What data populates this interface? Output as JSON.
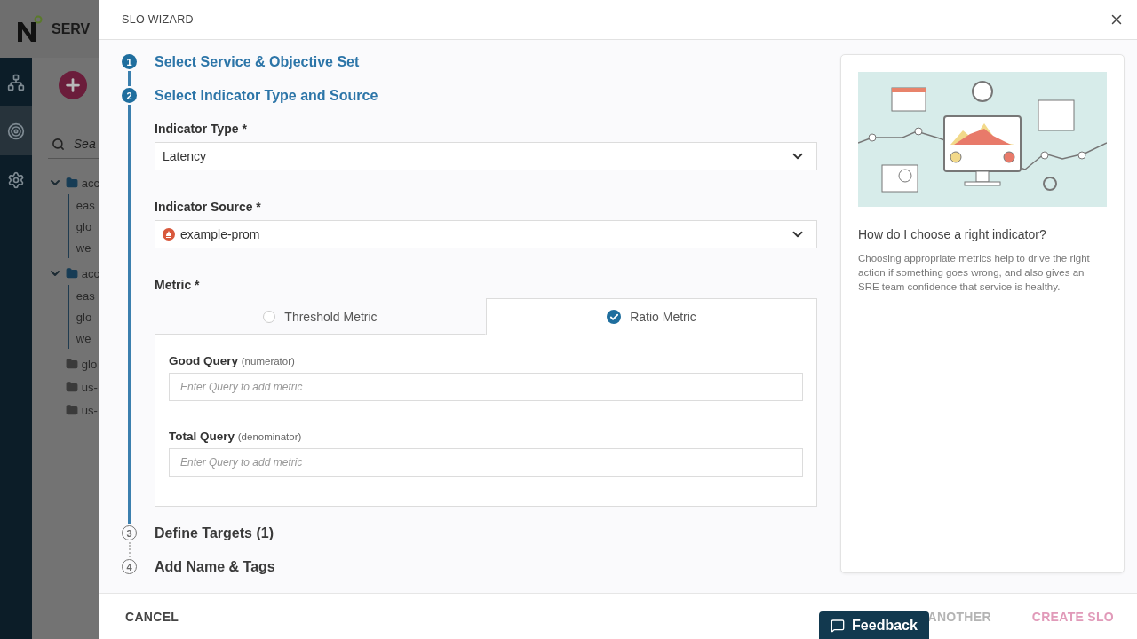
{
  "background_app": {
    "header_title": "SERV",
    "nav": [
      {
        "kind": "network",
        "selected": false
      },
      {
        "kind": "target",
        "selected": true
      },
      {
        "kind": "settings",
        "selected": false
      }
    ],
    "search": {
      "placeholder": "Sea"
    },
    "tree": [
      {
        "label": "acc",
        "expanded": true,
        "children": [
          {
            "label": "eas"
          },
          {
            "label": "glo"
          },
          {
            "label": "we"
          }
        ]
      },
      {
        "label": "acc",
        "expanded": true,
        "children": [
          {
            "label": "eas"
          },
          {
            "label": "glo"
          },
          {
            "label": "we"
          }
        ]
      },
      {
        "label": "glo",
        "expanded": false
      },
      {
        "label": "us-",
        "expanded": false
      },
      {
        "label": "us-",
        "expanded": false
      }
    ]
  },
  "wizard": {
    "title": "SLO WIZARD",
    "steps": [
      {
        "number": "1",
        "title": "Select Service & Objective Set",
        "active": true
      },
      {
        "number": "2",
        "title": "Select Indicator Type and Source",
        "active": true,
        "expanded": true
      },
      {
        "number": "3",
        "title": "Define Targets (1)",
        "active": false
      },
      {
        "number": "4",
        "title": "Add Name & Tags",
        "active": false
      }
    ],
    "form": {
      "indicator_type": {
        "label": "Indicator Type *",
        "value": "Latency"
      },
      "indicator_source": {
        "label": "Indicator Source *",
        "value": "example-prom"
      },
      "metric": {
        "label": "Metric *",
        "tabs": [
          {
            "label": "Threshold Metric",
            "selected": false
          },
          {
            "label": "Ratio Metric",
            "selected": true
          }
        ],
        "queries": [
          {
            "label": "Good Query",
            "hint": "(numerator)",
            "placeholder": "Enter Query to add metric"
          },
          {
            "label": "Total Query",
            "hint": "(denominator)",
            "placeholder": "Enter Query to add metric"
          }
        ]
      }
    },
    "help": {
      "title": "How do I choose a right indicator?",
      "text": "Choosing appropriate metrics help to drive the right action if something goes wrong, and also gives an SRE team confidence that service is healthy."
    },
    "footer": {
      "cancel": "CANCEL",
      "secondary": {
        "label": "ANOTHER",
        "disabled": true
      },
      "primary": {
        "label": "CREATE SLO",
        "disabled": true
      }
    }
  },
  "feedback": {
    "label": "Feedback"
  }
}
